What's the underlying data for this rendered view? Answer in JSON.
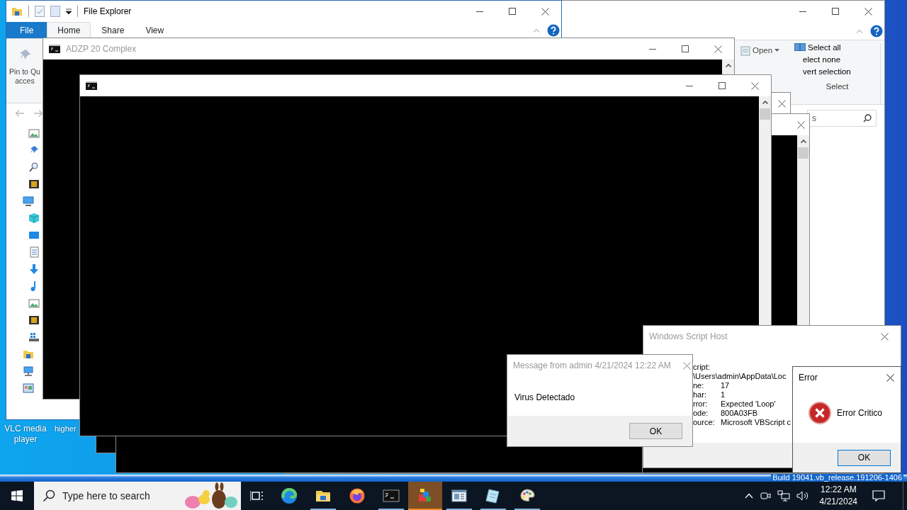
{
  "desktop": {
    "icons": [
      {
        "label": "VLC media player"
      },
      {
        "label": "higher"
      }
    ],
    "build_text": "Build 19041.vb_release.191206-1406"
  },
  "explorer_behind": {
    "ribbon": {
      "open": "Open",
      "select_all": "Select all",
      "select_none": "elect none",
      "invert_selection": "vert selection",
      "group": "Select"
    },
    "search_text": "s"
  },
  "explorer": {
    "title": "File Explorer",
    "tabs": [
      {
        "label": "File",
        "kind": "file",
        "selected": false
      },
      {
        "label": "Home",
        "kind": "tab",
        "selected": true
      },
      {
        "label": "Share",
        "kind": "tab",
        "selected": false
      },
      {
        "label": "View",
        "kind": "tab",
        "selected": false
      }
    ],
    "pin_label": [
      "Pin to Qu",
      "acces"
    ]
  },
  "consoles": [
    {
      "kind": "console"
    },
    {
      "kind": "console"
    },
    {
      "kind": "pane"
    },
    {
      "kind": "pane"
    },
    {
      "kind": "console",
      "title": "ADZP 20 Complex"
    },
    {
      "kind": "console"
    }
  ],
  "script_host": {
    "title": "Windows Script Host",
    "rows": [
      {
        "label": "cript:"
      },
      {
        "value": "\\Users\\admin\\AppData\\Loc"
      },
      {
        "label": "ne:",
        "value": "17"
      },
      {
        "label": "har:",
        "value": "1"
      },
      {
        "label": "rror:",
        "value": "Expected 'Loop'"
      },
      {
        "label": "ode:",
        "value": "800A03FB"
      },
      {
        "label": "ource:",
        "value": "Microsoft VBScript c"
      }
    ]
  },
  "message_box": {
    "title": "Message from admin 4/21/2024 12:22 AM",
    "text": "Virus Detectado",
    "button": "OK"
  },
  "error_dialog": {
    "title": "Error",
    "message": "Error Critico",
    "button": "OK"
  },
  "taskbar": {
    "search_placeholder": "Type here to search",
    "apps": [
      {
        "kind": "swirl",
        "running": false,
        "active": false
      },
      {
        "kind": "folder",
        "running": true,
        "active": false
      },
      {
        "kind": "flame",
        "running": false,
        "active": false
      },
      {
        "kind": "terminal",
        "running": true,
        "active": false
      },
      {
        "kind": "cubes",
        "running": true,
        "active": true
      },
      {
        "kind": "window",
        "running": true,
        "active": false
      },
      {
        "kind": "notepad",
        "running": true,
        "active": false
      },
      {
        "kind": "palette",
        "running": true,
        "active": false
      }
    ],
    "clock": {
      "time": "12:22 AM",
      "date": "4/21/2024"
    }
  }
}
